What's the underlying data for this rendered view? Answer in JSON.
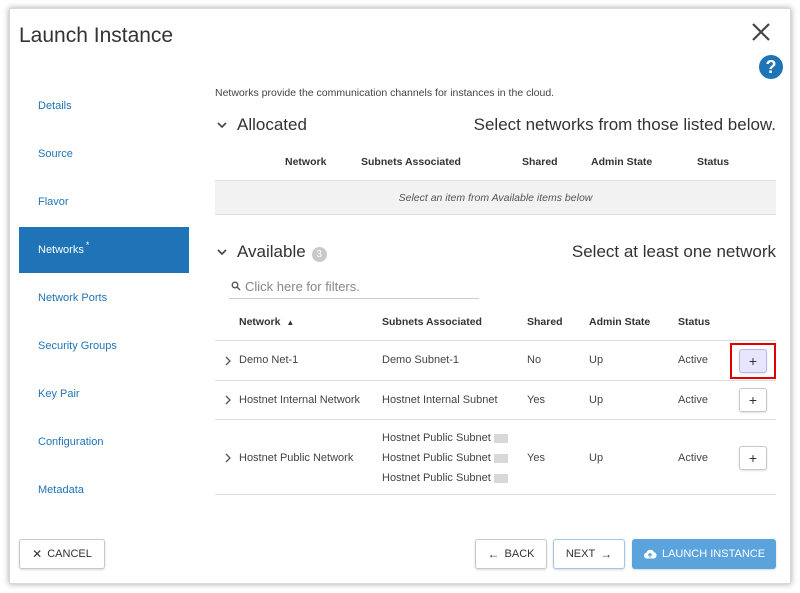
{
  "dialog": {
    "title": "Launch Instance",
    "help_icon": "?",
    "close_icon": "close-icon"
  },
  "nav": {
    "items": [
      {
        "label": "Details"
      },
      {
        "label": "Source"
      },
      {
        "label": "Flavor"
      },
      {
        "label": "Networks",
        "required_mark": "*"
      },
      {
        "label": "Network Ports"
      },
      {
        "label": "Security Groups"
      },
      {
        "label": "Key Pair"
      },
      {
        "label": "Configuration"
      },
      {
        "label": "Metadata"
      }
    ],
    "active": "Networks"
  },
  "intro": "Networks provide the communication channels for instances in the cloud.",
  "allocated": {
    "title": "Allocated",
    "hint": "Select networks from those listed below.",
    "columns": [
      "Network",
      "Subnets Associated",
      "Shared",
      "Admin State",
      "Status"
    ],
    "empty_message": "Select an item from Available items below"
  },
  "available": {
    "title": "Available",
    "count": "3",
    "hint": "Select at least one network",
    "filter_placeholder": "Click here for filters.",
    "columns": [
      "Network",
      "Subnets Associated",
      "Shared",
      "Admin State",
      "Status"
    ],
    "sort_indicator": "▲",
    "rows": [
      {
        "network": "Demo Net-1",
        "subnets": [
          "Demo Subnet-1"
        ],
        "shared": "No",
        "admin_state": "Up",
        "status": "Active",
        "action": "+"
      },
      {
        "network": "Hostnet Internal Network",
        "subnets": [
          "Hostnet Internal Subnet"
        ],
        "shared": "Yes",
        "admin_state": "Up",
        "status": "Active",
        "action": "+"
      },
      {
        "network": "Hostnet Public Network",
        "subnets": [
          "Hostnet Public Subnet",
          "Hostnet Public Subnet",
          "Hostnet Public Subnet"
        ],
        "shared": "Yes",
        "admin_state": "Up",
        "status": "Active",
        "action": "+"
      }
    ]
  },
  "footer": {
    "cancel": "CANCEL",
    "cancel_icon": "✕",
    "back": "BACK",
    "back_icon": "←",
    "next": "NEXT",
    "next_icon": "→",
    "launch": "LAUNCH INSTANCE"
  },
  "colors": {
    "accent": "#1f73b7",
    "primary_button": "#5aa3dd",
    "highlight": "#e10000"
  }
}
